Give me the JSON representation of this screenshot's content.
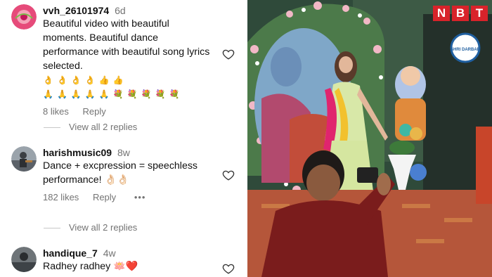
{
  "comments": [
    {
      "username": "vvh_26101974",
      "time": "6d",
      "text": "Beautiful video with beautiful moments. Beautiful dance performance with beautiful song lyrics selected.",
      "emoji_line_1": "👌👌👌👌👍👍",
      "emoji_line_2": "🙏🙏🙏🙏🙏💐💐💐💐💐",
      "likes": "8 likes",
      "reply_label": "Reply",
      "view_replies": "View all 2 replies"
    },
    {
      "username": "harishmusic09",
      "time": "8w",
      "text": "Dance + excpression = speechless performance! 👌🏻👌🏻",
      "likes": "182 likes",
      "reply_label": "Reply",
      "more": "•••",
      "view_replies": "View all 2 replies"
    },
    {
      "username": "handique_7",
      "time": "4w",
      "text": "Radhey radhey 🪷❤️"
    }
  ],
  "video": {
    "badge_letters": [
      "N",
      "B",
      "T"
    ],
    "banner_text": "SHRI DARBAR"
  },
  "colors": {
    "text": "#111111",
    "muted": "#737373",
    "badge": "#d8232a"
  }
}
